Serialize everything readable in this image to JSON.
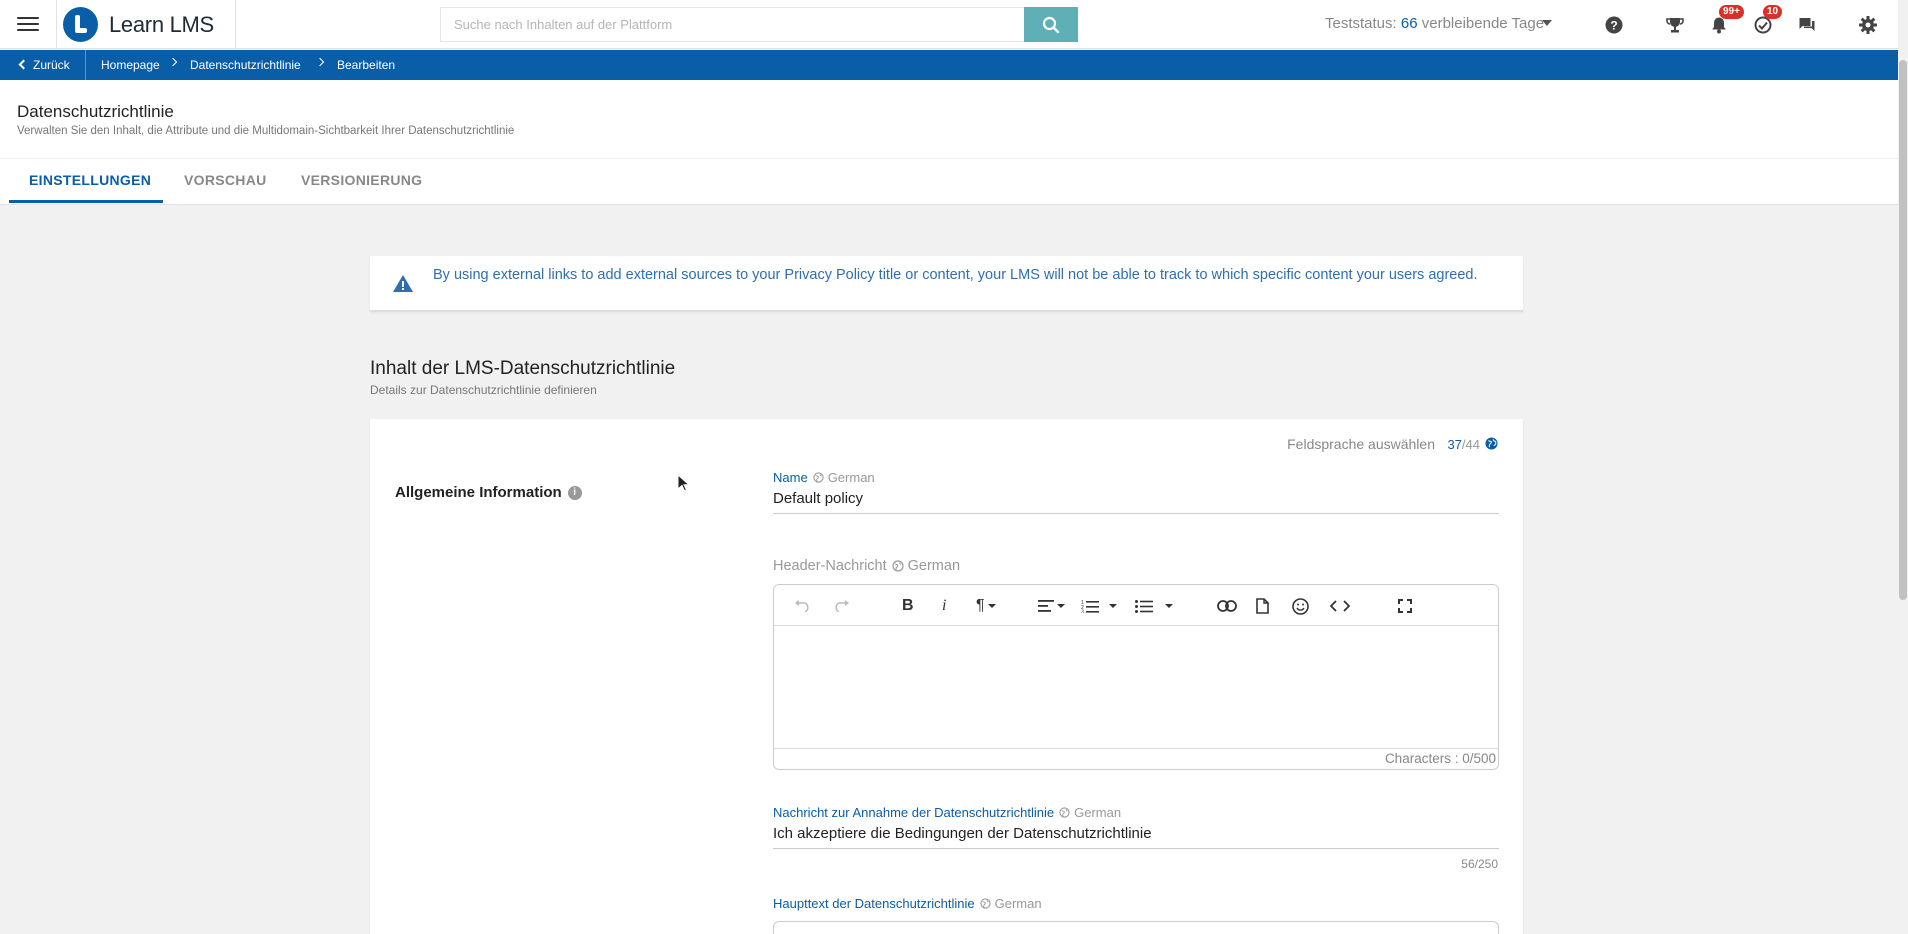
{
  "app": {
    "brand": "Learn LMS"
  },
  "search": {
    "placeholder": "Suche nach Inhalten auf der Plattform"
  },
  "trial": {
    "prefix": "Teststatus: ",
    "days": "66",
    "suffix": " verbleibende Tage"
  },
  "badges": {
    "notifications": "99+",
    "tasks": "10"
  },
  "breadcrumbs": {
    "back": "Zurück",
    "items": [
      "Homepage",
      "Datenschutzrichtlinie",
      "Bearbeiten"
    ]
  },
  "page": {
    "title": "Datenschutzrichtlinie",
    "subtitle": "Verwalten Sie den Inhalt, die Attribute und die Multidomain-Sichtbarkeit Ihrer Datenschutzrichtlinie"
  },
  "tabs": [
    "EINSTELLUNGEN",
    "VORSCHAU",
    "VERSIONIERUNG"
  ],
  "alert": {
    "text": "By using external links to add external sources to your Privacy Policy title or content, your LMS will not be able to track to which specific content your users agreed."
  },
  "section": {
    "title": "Inhalt der LMS-Datenschutzrichtlinie",
    "subtitle": "Details zur Datenschutzrichtlinie definieren"
  },
  "form": {
    "language_select": "Feldsprache auswählen",
    "language_current": "37",
    "language_total": "/44",
    "group_label": "Allgemeine Information",
    "name_label": "Name",
    "name_lang": "German",
    "name_value": "Default policy",
    "header_label": "Header-Nachricht",
    "header_lang": "German",
    "header_counter": "Characters : 0/500",
    "accept_label": "Nachricht zur Annahme der Datenschutzrichtlinie",
    "accept_lang": "German",
    "accept_value": "Ich akzeptiere die Bedingungen der Datenschutzrichtlinie",
    "accept_counter": "56/250",
    "main_label": "Haupttext der Datenschutzrichtlinie",
    "main_lang": "German"
  }
}
